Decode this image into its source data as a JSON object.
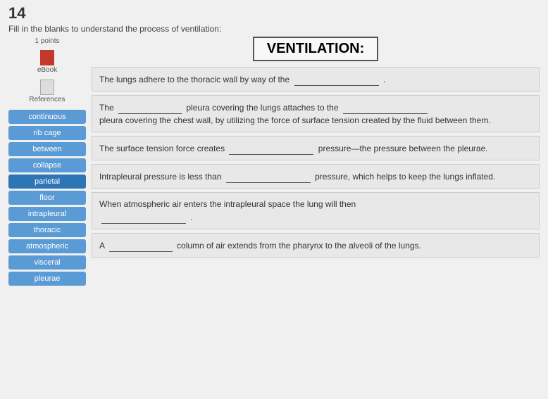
{
  "page": {
    "number": "14",
    "instruction": "Fill in the blanks to understand the process of ventilation:"
  },
  "left": {
    "points": "1\npoints",
    "ebook_label": "eBook",
    "references_label": "References"
  },
  "title": "VENTILATION:",
  "word_chips": [
    "continuous",
    "rib cage",
    "between",
    "collapse",
    "parietal",
    "floor",
    "intrapleural",
    "thoracic",
    "atmospheric",
    "visceral",
    "pleurae"
  ],
  "questions": [
    {
      "id": "q1",
      "text_before": "The lungs adhere to the thoracic wall by way of the",
      "blank": "",
      "text_after": "."
    },
    {
      "id": "q2",
      "line1_before": "The",
      "blank1": "",
      "line1_mid": "pleura covering the lungs attaches to the",
      "blank2": "",
      "line2": "pleura covering the chest wall, by utilizing the force of surface tension created by the fluid between them."
    },
    {
      "id": "q3",
      "text_before": "The surface tension force creates",
      "blank": "",
      "text_after": "pressure—the pressure between the pleurae."
    },
    {
      "id": "q4",
      "text_before": "Intrapleural pressure is less than",
      "blank": "",
      "text_after": "pressure, which helps to keep the lungs inflated."
    },
    {
      "id": "q5",
      "text_before": "When atmospheric air enters the intrapleural space the lung will then",
      "blank": "",
      "text_after": "."
    },
    {
      "id": "q6",
      "line1_before": "A",
      "blank": "",
      "line1_after": "column of air extends from the pharynx to the alveoli of the lungs."
    }
  ]
}
